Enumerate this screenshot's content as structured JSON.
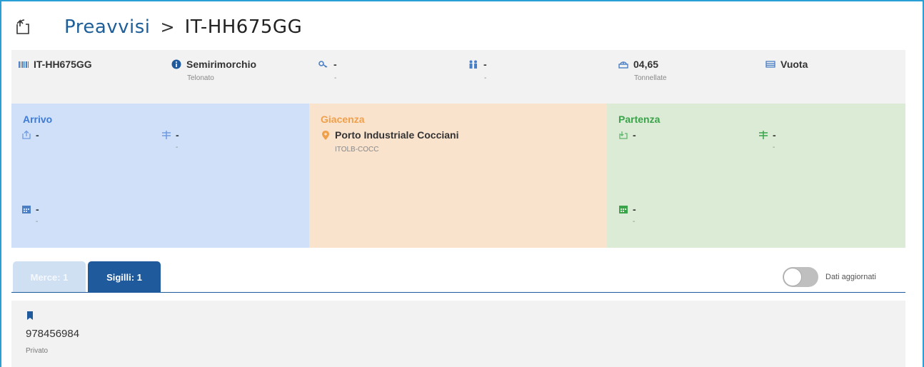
{
  "header": {
    "breadcrumb_root": "Preavvisi",
    "separator": ">",
    "current": "IT-HH675GG"
  },
  "info": {
    "plate": "IT-HH675GG",
    "vehicle_type": "Semirimorchio",
    "vehicle_subtype": "Telonato",
    "key_value": "-",
    "key_sub": "-",
    "people_value": "-",
    "people_sub": "-",
    "weight_value": "04,65",
    "weight_unit": "Tonnellate",
    "load_status": "Vuota"
  },
  "arrivo": {
    "title": "Arrivo",
    "f1_value": "-",
    "f2_value": "-",
    "f2_sub": "-",
    "f3_value": "-",
    "f3_sub": "-"
  },
  "giacenza": {
    "title": "Giacenza",
    "location_name": "Porto Industriale Cocciani",
    "location_code": "ITOLB-COCC"
  },
  "partenza": {
    "title": "Partenza",
    "f1_value": "-",
    "f2_value": "-",
    "f2_sub": "-",
    "f3_value": "-",
    "f3_sub": "-"
  },
  "tabs": [
    {
      "label": "Merce: 1"
    },
    {
      "label": "Sigilli: 1"
    }
  ],
  "toggle": {
    "label": "Dati aggiornati",
    "on": false
  },
  "seal": {
    "number": "978456984",
    "type": "Privato"
  },
  "colors": {
    "accent": "#1e5a9c",
    "arrivo_text": "#3d7bd6",
    "giacenza_text": "#f0a04a",
    "partenza_text": "#3aa34a",
    "frame": "#2a9fd6"
  }
}
